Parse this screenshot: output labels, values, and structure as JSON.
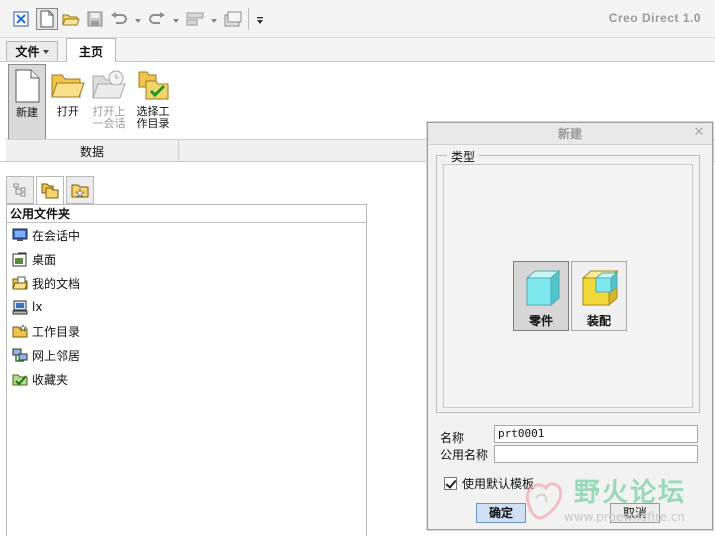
{
  "app": {
    "title": "Creo Direct 1.0"
  },
  "quick_access": {
    "icons": [
      "close-window-icon",
      "new-icon",
      "open-icon",
      "save-icon",
      "undo-icon",
      "redo-icon",
      "regenerate-icon",
      "windows-icon",
      "more-icon"
    ]
  },
  "ribbon": {
    "tabs": {
      "file": "文件",
      "home": "主页"
    },
    "buttons": {
      "new": "新建",
      "open": "打开",
      "open_last_session": "打开上\n一会话",
      "select_working_dir": "选择工\n作目录"
    },
    "group_label": "数据"
  },
  "navigator": {
    "header": "公用文件夹",
    "items": [
      {
        "label": "在会话中",
        "icon": "in-session-icon"
      },
      {
        "label": "桌面",
        "icon": "desktop-icon"
      },
      {
        "label": "我的文档",
        "icon": "my-documents-icon"
      },
      {
        "label": "lx",
        "icon": "computer-icon"
      },
      {
        "label": "工作目录",
        "icon": "working-directory-icon"
      },
      {
        "label": "网上邻居",
        "icon": "network-icon"
      },
      {
        "label": "收藏夹",
        "icon": "favorites-icon"
      }
    ]
  },
  "dialog": {
    "title": "新建",
    "type_legend": "类型",
    "types": {
      "part": "零件",
      "assembly": "装配"
    },
    "name_label": "名称",
    "name_value": "prt0001",
    "common_name_label": "公用名称",
    "common_name_value": "",
    "use_default_template": "使用默认模板",
    "ok": "确定",
    "cancel": "取消"
  },
  "watermark": {
    "text": "野火论坛",
    "url": "www.proewildfire.cn"
  },
  "colors": {
    "part_cyan": "#7ee8ee",
    "assembly_yellow": "#f2d93a",
    "primary_button": "#cfe0f5"
  }
}
